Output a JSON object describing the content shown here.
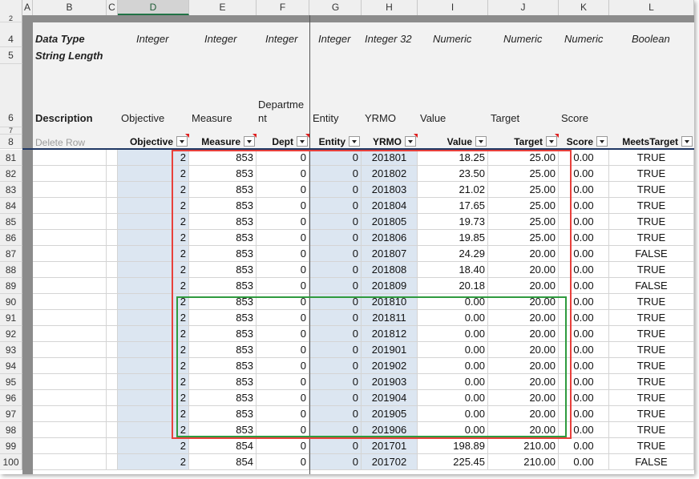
{
  "columns": [
    "A",
    "B",
    "C",
    "D",
    "E",
    "F",
    "G",
    "H",
    "I",
    "J",
    "K",
    "L"
  ],
  "meta_rows": {
    "row_labels": [
      "2",
      "4",
      "5",
      "6",
      "7",
      "8"
    ],
    "data_type_label": "Data Type",
    "string_length_label": "String Length",
    "description_label": "Description",
    "data_types": [
      "Integer",
      "Integer",
      "Integer",
      "Integer",
      "Integer 32",
      "Numeric",
      "Numeric",
      "Numeric",
      "Boolean"
    ],
    "descriptions": [
      "Objective",
      "Measure",
      "Departme nt",
      "Entity",
      "YRMO",
      "Value",
      "Target",
      "Score"
    ],
    "delete_row_label": "Delete Row"
  },
  "headers": [
    "Objective",
    "Measure",
    "Dept",
    "Entity",
    "YRMO",
    "Value",
    "Target",
    "Score",
    "MeetsTarget"
  ],
  "rows": [
    {
      "num": "81",
      "objective": "2",
      "measure": "853",
      "dept": "0",
      "entity": "0",
      "yrmo": "201801",
      "value": "18.25",
      "target": "25.00",
      "score": "0.00",
      "meets": "TRUE"
    },
    {
      "num": "82",
      "objective": "2",
      "measure": "853",
      "dept": "0",
      "entity": "0",
      "yrmo": "201802",
      "value": "23.50",
      "target": "25.00",
      "score": "0.00",
      "meets": "TRUE"
    },
    {
      "num": "83",
      "objective": "2",
      "measure": "853",
      "dept": "0",
      "entity": "0",
      "yrmo": "201803",
      "value": "21.02",
      "target": "25.00",
      "score": "0.00",
      "meets": "TRUE"
    },
    {
      "num": "84",
      "objective": "2",
      "measure": "853",
      "dept": "0",
      "entity": "0",
      "yrmo": "201804",
      "value": "17.65",
      "target": "25.00",
      "score": "0.00",
      "meets": "TRUE"
    },
    {
      "num": "85",
      "objective": "2",
      "measure": "853",
      "dept": "0",
      "entity": "0",
      "yrmo": "201805",
      "value": "19.73",
      "target": "25.00",
      "score": "0.00",
      "meets": "TRUE"
    },
    {
      "num": "86",
      "objective": "2",
      "measure": "853",
      "dept": "0",
      "entity": "0",
      "yrmo": "201806",
      "value": "19.85",
      "target": "25.00",
      "score": "0.00",
      "meets": "TRUE"
    },
    {
      "num": "87",
      "objective": "2",
      "measure": "853",
      "dept": "0",
      "entity": "0",
      "yrmo": "201807",
      "value": "24.29",
      "target": "20.00",
      "score": "0.00",
      "meets": "FALSE"
    },
    {
      "num": "88",
      "objective": "2",
      "measure": "853",
      "dept": "0",
      "entity": "0",
      "yrmo": "201808",
      "value": "18.40",
      "target": "20.00",
      "score": "0.00",
      "meets": "TRUE"
    },
    {
      "num": "89",
      "objective": "2",
      "measure": "853",
      "dept": "0",
      "entity": "0",
      "yrmo": "201809",
      "value": "20.18",
      "target": "20.00",
      "score": "0.00",
      "meets": "FALSE"
    },
    {
      "num": "90",
      "objective": "2",
      "measure": "853",
      "dept": "0",
      "entity": "0",
      "yrmo": "201810",
      "value": "0.00",
      "target": "20.00",
      "score": "0.00",
      "meets": "TRUE"
    },
    {
      "num": "91",
      "objective": "2",
      "measure": "853",
      "dept": "0",
      "entity": "0",
      "yrmo": "201811",
      "value": "0.00",
      "target": "20.00",
      "score": "0.00",
      "meets": "TRUE"
    },
    {
      "num": "92",
      "objective": "2",
      "measure": "853",
      "dept": "0",
      "entity": "0",
      "yrmo": "201812",
      "value": "0.00",
      "target": "20.00",
      "score": "0.00",
      "meets": "TRUE"
    },
    {
      "num": "93",
      "objective": "2",
      "measure": "853",
      "dept": "0",
      "entity": "0",
      "yrmo": "201901",
      "value": "0.00",
      "target": "20.00",
      "score": "0.00",
      "meets": "TRUE"
    },
    {
      "num": "94",
      "objective": "2",
      "measure": "853",
      "dept": "0",
      "entity": "0",
      "yrmo": "201902",
      "value": "0.00",
      "target": "20.00",
      "score": "0.00",
      "meets": "TRUE"
    },
    {
      "num": "95",
      "objective": "2",
      "measure": "853",
      "dept": "0",
      "entity": "0",
      "yrmo": "201903",
      "value": "0.00",
      "target": "20.00",
      "score": "0.00",
      "meets": "TRUE"
    },
    {
      "num": "96",
      "objective": "2",
      "measure": "853",
      "dept": "0",
      "entity": "0",
      "yrmo": "201904",
      "value": "0.00",
      "target": "20.00",
      "score": "0.00",
      "meets": "TRUE"
    },
    {
      "num": "97",
      "objective": "2",
      "measure": "853",
      "dept": "0",
      "entity": "0",
      "yrmo": "201905",
      "value": "0.00",
      "target": "20.00",
      "score": "0.00",
      "meets": "TRUE"
    },
    {
      "num": "98",
      "objective": "2",
      "measure": "853",
      "dept": "0",
      "entity": "0",
      "yrmo": "201906",
      "value": "0.00",
      "target": "20.00",
      "score": "0.00",
      "meets": "TRUE"
    },
    {
      "num": "99",
      "objective": "2",
      "measure": "854",
      "dept": "0",
      "entity": "0",
      "yrmo": "201701",
      "value": "198.89",
      "target": "210.00",
      "score": "0.00",
      "meets": "TRUE"
    },
    {
      "num": "100",
      "objective": "2",
      "measure": "854",
      "dept": "0",
      "entity": "0",
      "yrmo": "201702",
      "value": "225.45",
      "target": "210.00",
      "score": "0.00",
      "meets": "FALSE"
    }
  ],
  "colors": {
    "selected_column_fill": "#dce6f1",
    "red_highlight": "#e8413c",
    "green_highlight": "#2f9a3e",
    "header_gray": "#efefef"
  }
}
